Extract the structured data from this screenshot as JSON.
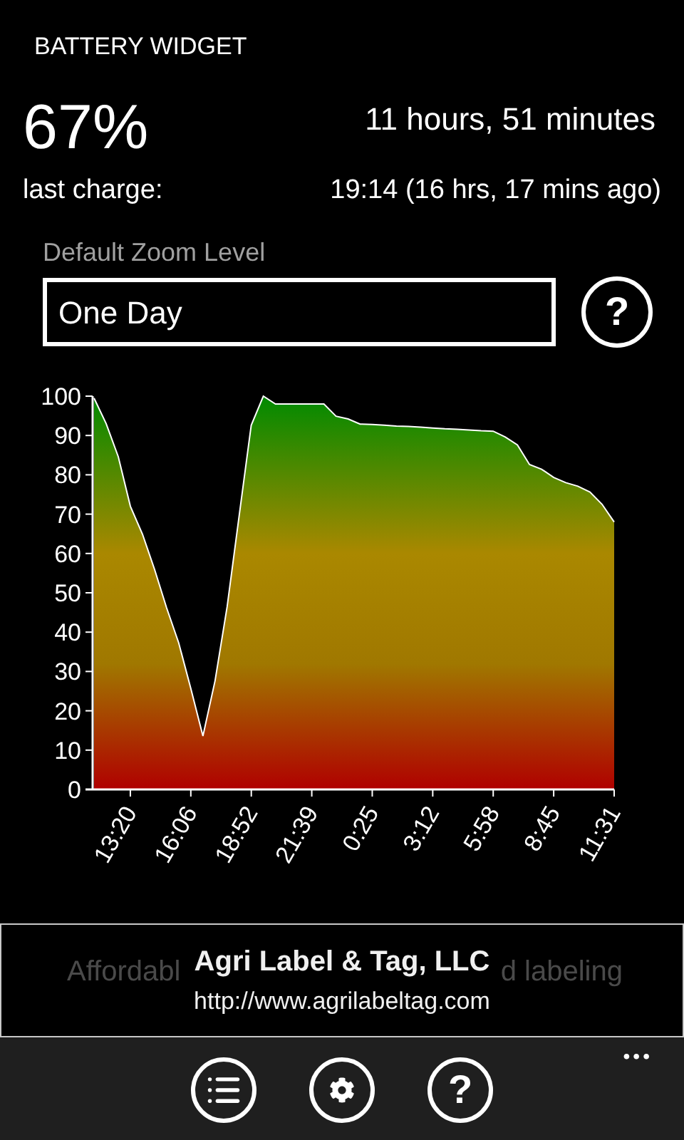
{
  "app_title": "BATTERY WIDGET",
  "battery": {
    "percent": "67%",
    "remaining": "11 hours, 51 minutes",
    "last_charge_label": "last charge:",
    "last_charge_value": "19:14 (16 hrs, 17 mins ago)"
  },
  "zoom_setting": {
    "label": "Default Zoom Level",
    "value": "One Day",
    "help_glyph": "?"
  },
  "chart_data": {
    "type": "area",
    "ylim": [
      0,
      100
    ],
    "yticks": [
      0,
      10,
      20,
      30,
      40,
      50,
      60,
      70,
      80,
      90,
      100
    ],
    "categories": [
      null,
      null,
      null,
      "13:20",
      null,
      null,
      null,
      null,
      "16:06",
      null,
      null,
      null,
      null,
      "18:52",
      null,
      null,
      null,
      null,
      "21:39",
      null,
      null,
      null,
      null,
      "0:25",
      null,
      null,
      null,
      null,
      "3:12",
      null,
      null,
      null,
      null,
      "5:58",
      null,
      null,
      null,
      null,
      "8:45",
      null,
      null,
      null,
      null,
      "11:31"
    ],
    "series": [
      {
        "color": "#ffffff",
        "values": [
          99.5,
          93,
          84.6,
          72,
          64.9,
          56,
          46.2,
          37.3,
          25.7,
          13.6,
          27.6,
          46.5,
          69.8,
          92.6,
          100,
          98,
          98,
          98,
          98,
          98,
          94.9,
          94.2,
          92.9,
          92.8,
          92.6,
          92.4,
          92.3,
          92.1,
          91.9,
          91.7,
          91.6,
          91.4,
          91.2,
          91.1,
          89.6,
          87.6,
          82.6,
          81.4,
          79.3,
          78,
          77.1,
          75.6,
          72.5,
          68
        ]
      }
    ]
  },
  "ad": {
    "background_left": "Affordabl",
    "background_right": "d labeling",
    "title": "Agri Label & Tag, LLC",
    "url": "http://www.agrilabeltag.com"
  },
  "app_bar": {
    "buttons": [
      {
        "kind": "list"
      },
      {
        "kind": "settings"
      },
      {
        "kind": "help",
        "glyph": "?"
      }
    ],
    "more": "•••"
  }
}
